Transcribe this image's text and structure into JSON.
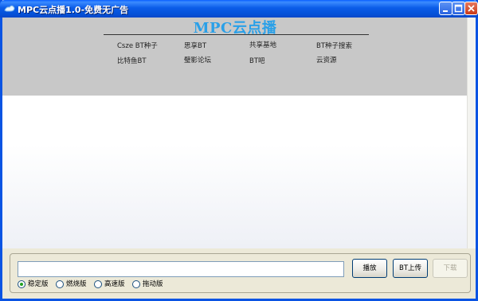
{
  "window": {
    "title": "MPC云点播1.0-免费无广告"
  },
  "header": {
    "brand": "MPC云点播",
    "links": [
      "Csze BT种子",
      "思享BT",
      "共享基地",
      "BT种子搜索",
      "比特鱼BT",
      "璧影论坛",
      "BT吧",
      "云资源"
    ]
  },
  "controls": {
    "url_value": "",
    "play_label": "播放",
    "upload_label": "BT上传",
    "download_label": "下载",
    "modes": [
      "稳定版",
      "燃烧版",
      "高速版",
      "拖动版"
    ],
    "selected_mode": "稳定版"
  }
}
